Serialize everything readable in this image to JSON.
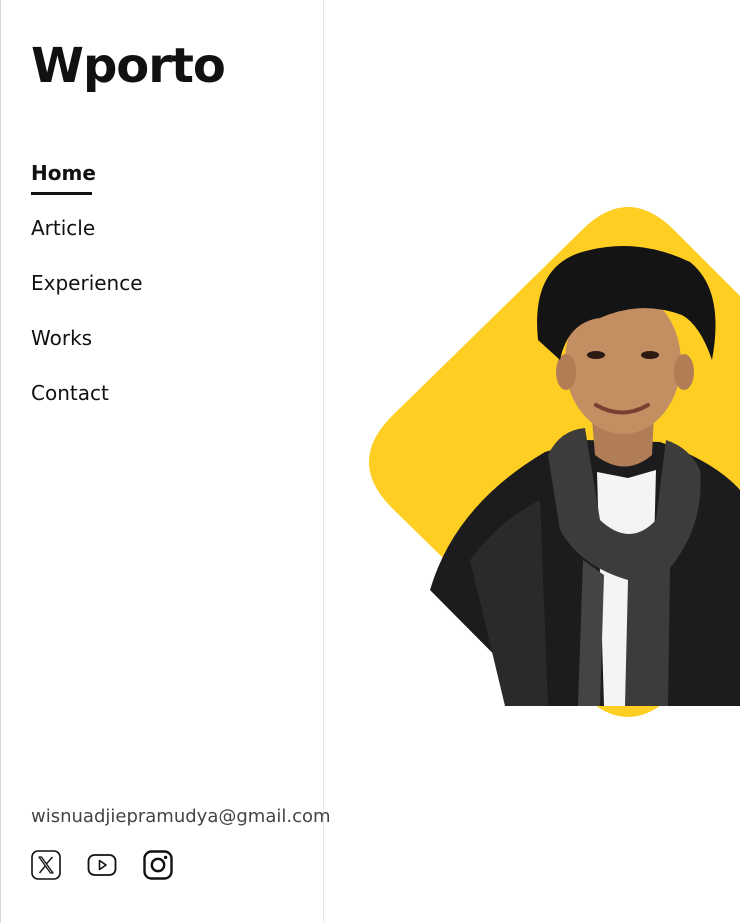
{
  "brand": {
    "name": "Wporto"
  },
  "nav": {
    "items": [
      {
        "label": "Home"
      },
      {
        "label": "Article"
      },
      {
        "label": "Experience"
      },
      {
        "label": "Works"
      },
      {
        "label": "Contact"
      }
    ],
    "active_index": 0
  },
  "footer": {
    "email": "wisnuadjiepramudya@gmail.com",
    "social_icons": [
      "x-icon",
      "youtube-icon",
      "instagram-icon"
    ]
  },
  "hero": {
    "accent_color": "#FFCE22",
    "image": "portrait-photo"
  }
}
